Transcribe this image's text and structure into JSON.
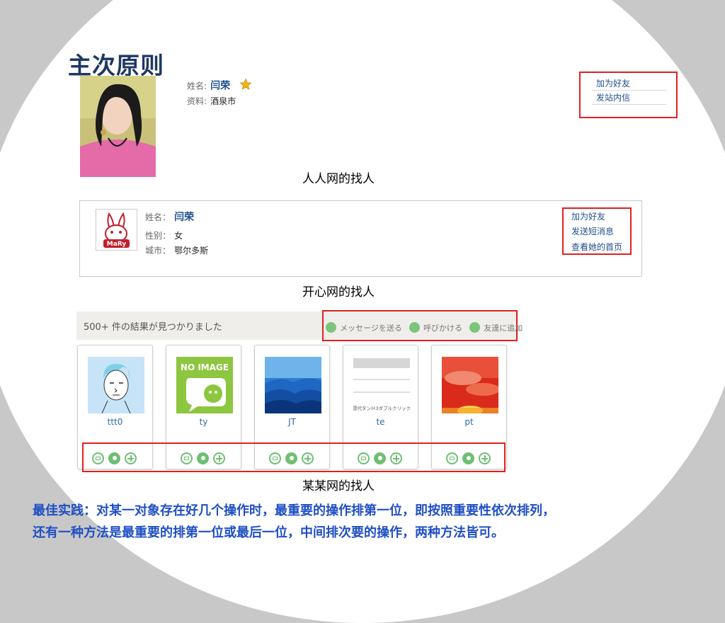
{
  "title": "主次原则",
  "renren": {
    "name_label": "姓名:",
    "name": "闫荣",
    "info_label": "资料:",
    "info": "酒泉市",
    "actions": [
      "加为好友",
      "发站内信"
    ],
    "caption": "人人网的找人"
  },
  "kaixin": {
    "name_label": "姓名：",
    "name": "闫荣",
    "gender_label": "性别：",
    "gender": "女",
    "city_label": "城市：",
    "city": "鄂尔多斯",
    "avatar_text": "MaRy",
    "actions": [
      "加为好友",
      "发送短消息",
      "查看她的首页"
    ],
    "caption": "开心网的找人"
  },
  "some_site": {
    "result_text": "500+ 件の結果が見つかりました",
    "actions": [
      "メッセージを送る",
      "呼びかける",
      "友達に追加"
    ],
    "users": [
      "ttt0",
      "ty",
      "JT",
      "te",
      "pt"
    ],
    "no_image_text": "NO IMAGE",
    "te_thumb_text": "雪代タンＨ3ダブルクリック",
    "caption": "某某网的找人"
  },
  "best_practice": [
    "最佳实践：对某一对象存在好几个操作时，最重要的操作排第一位，即按照重要性依次排列，",
    "还有一种方法是最重要的排第一位或最后一位，中间排次要的操作，两种方法皆可。"
  ],
  "colors": {
    "title": "#1f3864",
    "highlight": "#e02020",
    "link": "#1f4e8c",
    "practice": "#1f4fc4",
    "action_green": "#6fbf73"
  }
}
